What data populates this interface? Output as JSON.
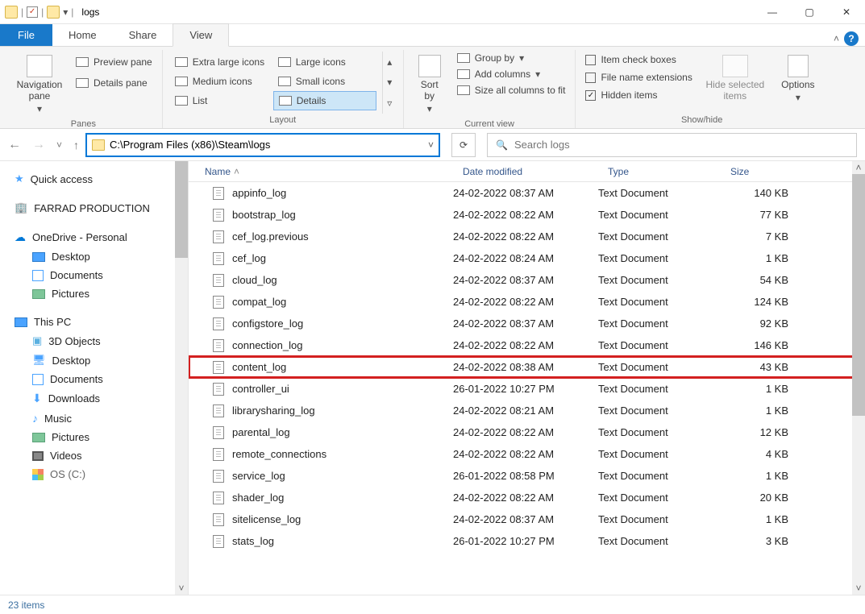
{
  "window": {
    "title": "logs",
    "min": "—",
    "max": "▢",
    "close": "✕",
    "collapse_ribbon": "˄"
  },
  "tabs": {
    "file": "File",
    "home": "Home",
    "share": "Share",
    "view": "View"
  },
  "ribbon": {
    "panes": {
      "nav": "Navigation\npane",
      "preview": "Preview pane",
      "details": "Details pane",
      "label": "Panes"
    },
    "layout": {
      "xl": "Extra large icons",
      "lg": "Large icons",
      "md": "Medium icons",
      "sm": "Small icons",
      "list": "List",
      "details": "Details",
      "label": "Layout"
    },
    "currentview": {
      "sort": "Sort\nby",
      "group": "Group by",
      "addcols": "Add columns",
      "sizecols": "Size all columns to fit",
      "label": "Current view"
    },
    "showhide": {
      "itemcheck": "Item check boxes",
      "fne": "File name extensions",
      "hidden": "Hidden items",
      "hidesel": "Hide selected\nitems",
      "options": "Options",
      "label": "Show/hide"
    }
  },
  "address": {
    "path": "C:\\Program Files (x86)\\Steam\\logs",
    "search_placeholder": "Search logs"
  },
  "tree": {
    "quick": "Quick access",
    "farrad": "FARRAD PRODUCTION",
    "onedrive": "OneDrive - Personal",
    "od_desktop": "Desktop",
    "od_docs": "Documents",
    "od_pics": "Pictures",
    "thispc": "This PC",
    "pc_3d": "3D Objects",
    "pc_desktop": "Desktop",
    "pc_docs": "Documents",
    "pc_dl": "Downloads",
    "pc_music": "Music",
    "pc_pics": "Pictures",
    "pc_videos": "Videos",
    "pc_os": "OS (C:)"
  },
  "columns": {
    "name": "Name",
    "date": "Date modified",
    "type": "Type",
    "size": "Size"
  },
  "files": [
    {
      "name": "appinfo_log",
      "date": "24-02-2022 08:37 AM",
      "type": "Text Document",
      "size": "140 KB",
      "hl": false
    },
    {
      "name": "bootstrap_log",
      "date": "24-02-2022 08:22 AM",
      "type": "Text Document",
      "size": "77 KB",
      "hl": false
    },
    {
      "name": "cef_log.previous",
      "date": "24-02-2022 08:22 AM",
      "type": "Text Document",
      "size": "7 KB",
      "hl": false
    },
    {
      "name": "cef_log",
      "date": "24-02-2022 08:24 AM",
      "type": "Text Document",
      "size": "1 KB",
      "hl": false
    },
    {
      "name": "cloud_log",
      "date": "24-02-2022 08:37 AM",
      "type": "Text Document",
      "size": "54 KB",
      "hl": false
    },
    {
      "name": "compat_log",
      "date": "24-02-2022 08:22 AM",
      "type": "Text Document",
      "size": "124 KB",
      "hl": false
    },
    {
      "name": "configstore_log",
      "date": "24-02-2022 08:37 AM",
      "type": "Text Document",
      "size": "92 KB",
      "hl": false
    },
    {
      "name": "connection_log",
      "date": "24-02-2022 08:22 AM",
      "type": "Text Document",
      "size": "146 KB",
      "hl": false
    },
    {
      "name": "content_log",
      "date": "24-02-2022 08:38 AM",
      "type": "Text Document",
      "size": "43 KB",
      "hl": true
    },
    {
      "name": "controller_ui",
      "date": "26-01-2022 10:27 PM",
      "type": "Text Document",
      "size": "1 KB",
      "hl": false
    },
    {
      "name": "librarysharing_log",
      "date": "24-02-2022 08:21 AM",
      "type": "Text Document",
      "size": "1 KB",
      "hl": false
    },
    {
      "name": "parental_log",
      "date": "24-02-2022 08:22 AM",
      "type": "Text Document",
      "size": "12 KB",
      "hl": false
    },
    {
      "name": "remote_connections",
      "date": "24-02-2022 08:22 AM",
      "type": "Text Document",
      "size": "4 KB",
      "hl": false
    },
    {
      "name": "service_log",
      "date": "26-01-2022 08:58 PM",
      "type": "Text Document",
      "size": "1 KB",
      "hl": false
    },
    {
      "name": "shader_log",
      "date": "24-02-2022 08:22 AM",
      "type": "Text Document",
      "size": "20 KB",
      "hl": false
    },
    {
      "name": "sitelicense_log",
      "date": "24-02-2022 08:37 AM",
      "type": "Text Document",
      "size": "1 KB",
      "hl": false
    },
    {
      "name": "stats_log",
      "date": "26-01-2022 10:27 PM",
      "type": "Text Document",
      "size": "3 KB",
      "hl": false
    }
  ],
  "status": {
    "count": "23 items"
  }
}
